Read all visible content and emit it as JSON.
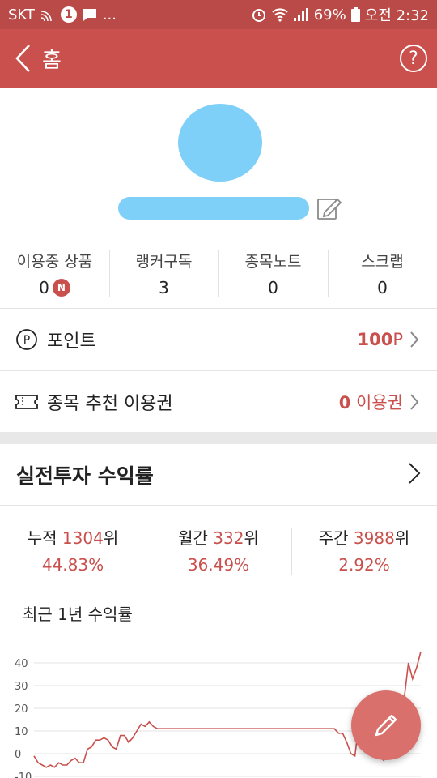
{
  "status_bar": {
    "carrier": "SKT",
    "notification_count": "1",
    "more": "...",
    "battery": "69%",
    "time": "오전 2:32"
  },
  "app_bar": {
    "title": "홈"
  },
  "stats": [
    {
      "label": "이용중 상품",
      "value": "0",
      "badge": "N"
    },
    {
      "label": "랭커구독",
      "value": "3"
    },
    {
      "label": "종목노트",
      "value": "0"
    },
    {
      "label": "스크랩",
      "value": "0"
    }
  ],
  "point_row": {
    "icon_letter": "P",
    "label": "포인트",
    "value": "100",
    "unit": "P"
  },
  "coupon_row": {
    "label": "종목 추천 이용권",
    "value": "0",
    "unit": " 이용권"
  },
  "returns": {
    "title": "실전투자 수익률",
    "ranks": [
      {
        "period": "누적",
        "rank": "1304",
        "suffix": "위",
        "pct": "44.83%"
      },
      {
        "period": "월간",
        "rank": "332",
        "suffix": "위",
        "pct": "36.49%"
      },
      {
        "period": "주간",
        "rank": "3988",
        "suffix": "위",
        "pct": "2.92%"
      }
    ],
    "chart_title": "최근 1년 수익률"
  },
  "colors": {
    "brand": "#c9504c",
    "status_bar": "#b94a47",
    "accent_text": "#c9504c",
    "placeholder": "#7fd0f8"
  },
  "chart_data": {
    "type": "line",
    "title": "최근 1년 수익률",
    "ylim": [
      -10,
      45
    ],
    "yticks": [
      "40",
      "30",
      "20",
      "10",
      "0",
      "-10"
    ],
    "grid": true,
    "series": [
      {
        "values": [
          -1,
          -4,
          -5,
          -6,
          -5,
          -6,
          -4,
          -5,
          -5,
          -3,
          -2,
          -4,
          -4,
          2,
          3,
          6,
          6,
          7,
          6,
          3,
          2,
          8,
          8,
          5,
          7,
          10,
          13,
          12,
          14,
          12,
          11,
          11,
          11,
          11,
          11,
          11,
          11,
          11,
          11,
          11,
          11,
          11,
          11,
          11,
          11,
          11,
          11,
          11,
          11,
          11,
          11,
          11,
          11,
          11,
          11,
          11,
          11,
          11,
          11,
          11,
          11,
          11,
          11,
          11,
          11,
          11,
          11,
          11,
          11,
          11,
          11,
          11,
          11,
          11,
          9,
          9,
          5,
          0,
          -1,
          14,
          11,
          5,
          7,
          10,
          -1,
          -3,
          0,
          5,
          10,
          20,
          25,
          40,
          33,
          38,
          45
        ]
      }
    ]
  }
}
